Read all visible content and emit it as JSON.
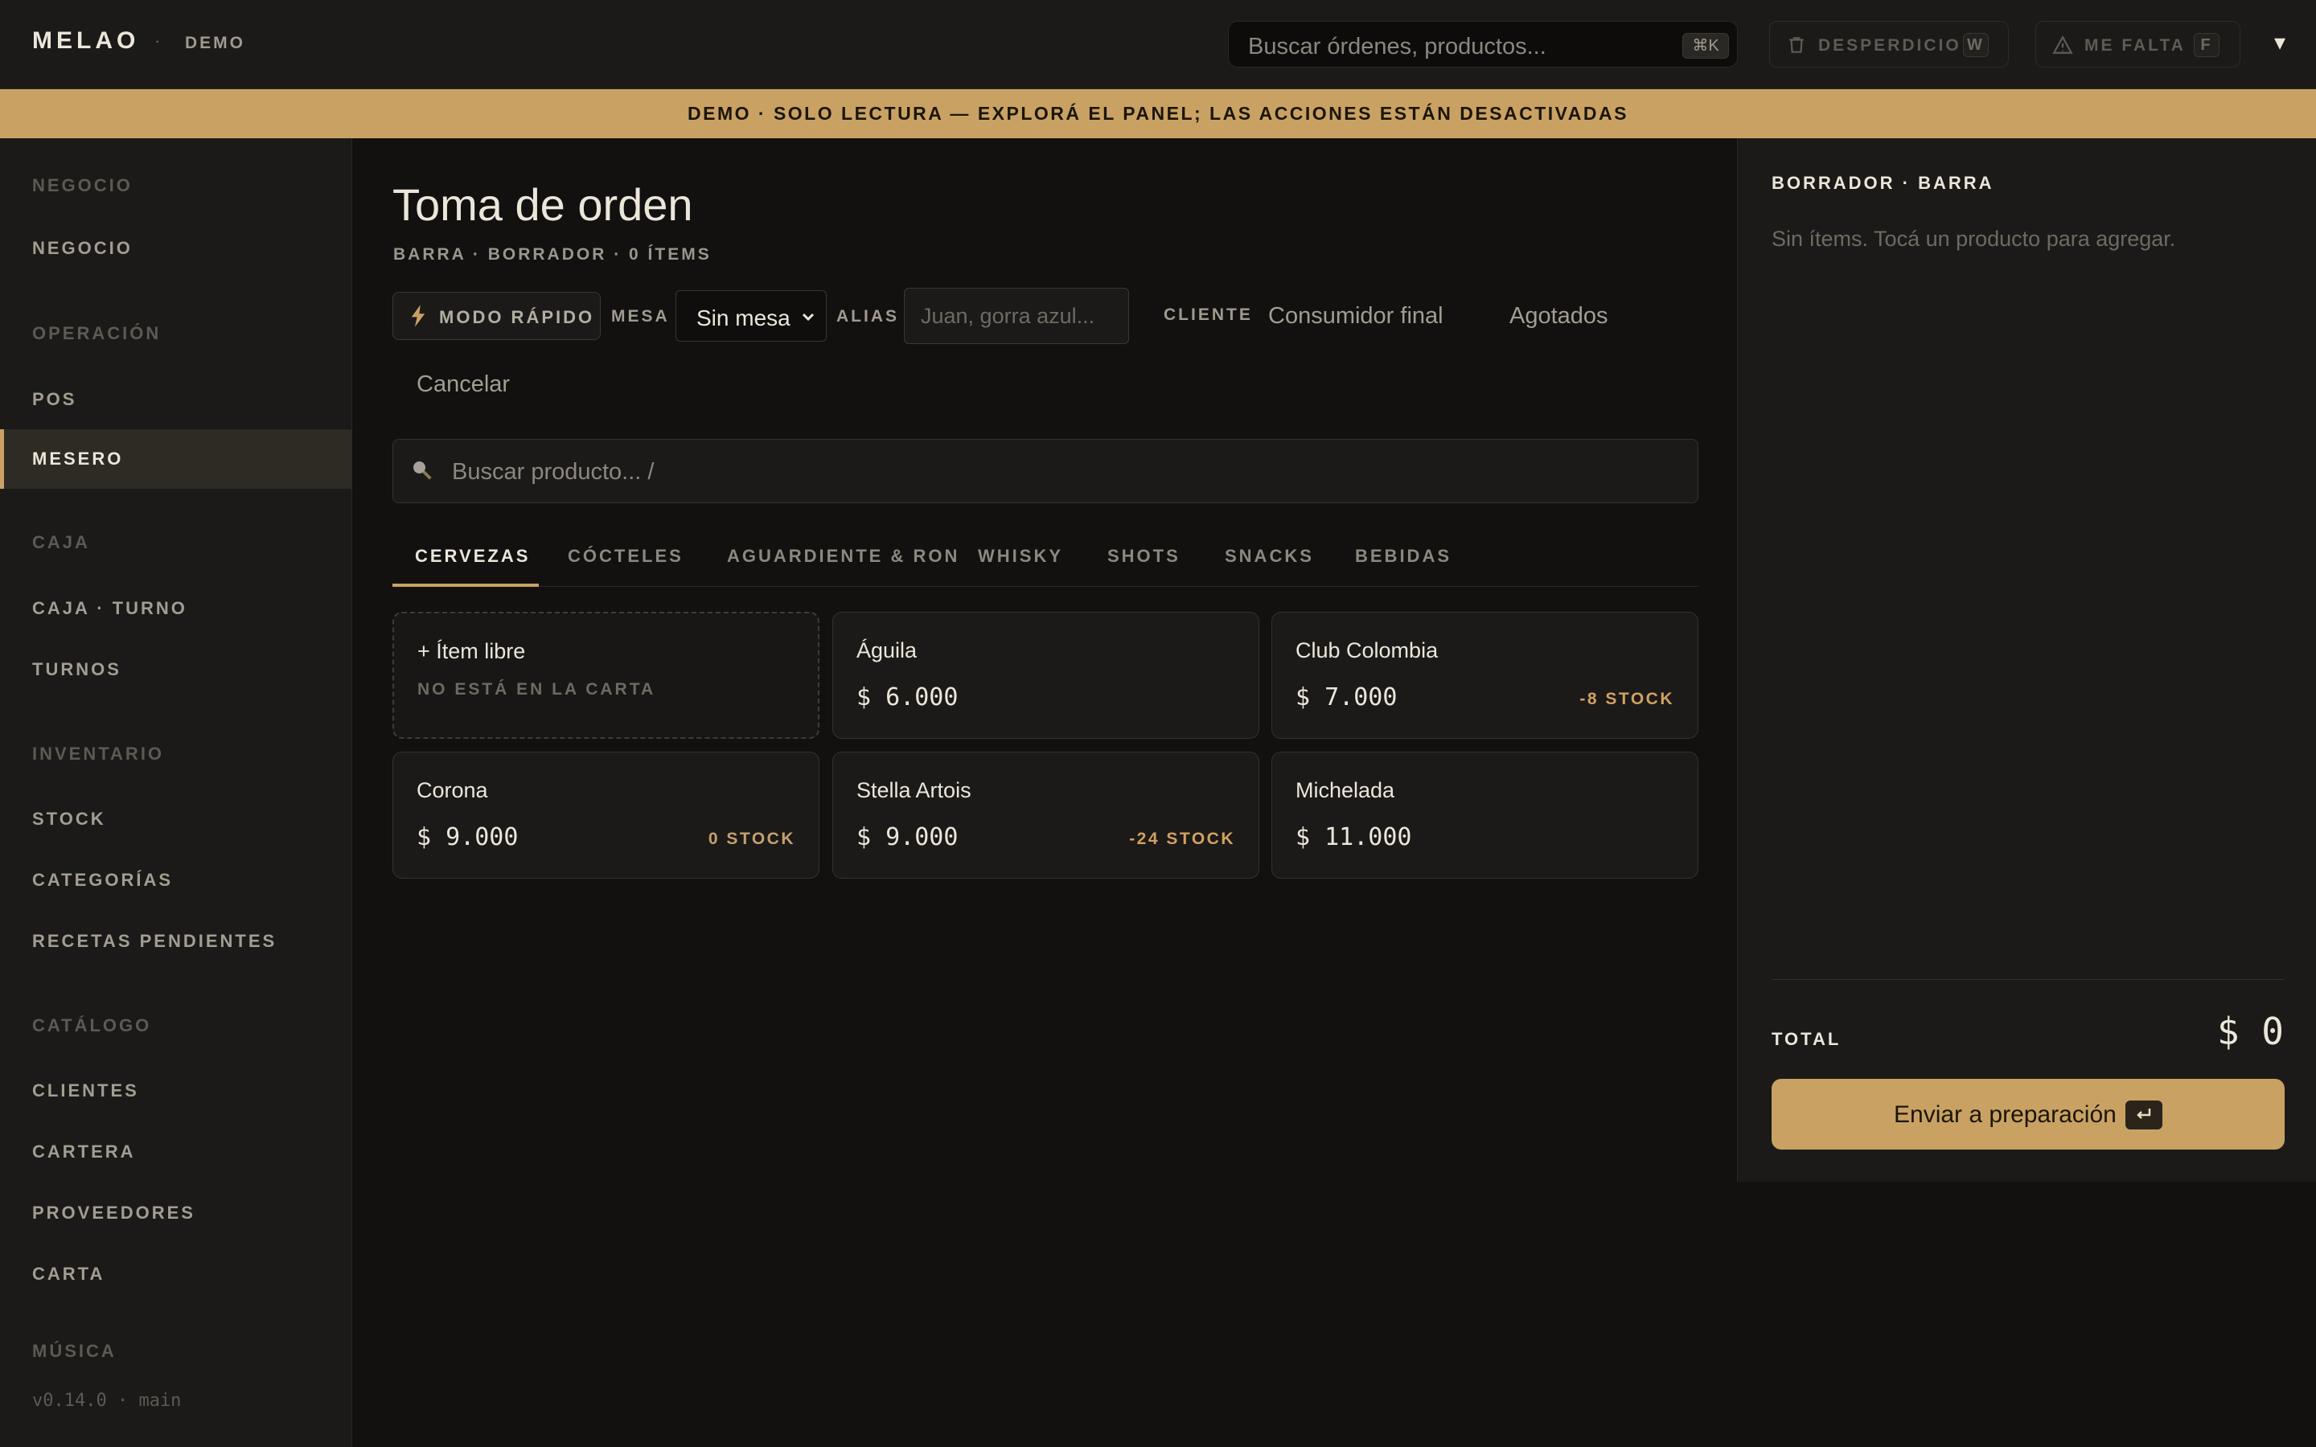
{
  "topbar": {
    "brand": "MELAO",
    "separator": "·",
    "badge": "DEMO",
    "search_placeholder": "Buscar órdenes, productos...",
    "search_shortcut": "⌘K",
    "waste_label": "DESPERDICIO",
    "waste_shortcut": "W",
    "missing_label": "ME FALTA",
    "missing_shortcut": "F",
    "more": "▾"
  },
  "banner": "DEMO · SOLO LECTURA — EXPLORÁ EL PANEL; LAS ACCIONES ESTÁN DESACTIVADAS",
  "sidebar": {
    "sections": [
      {
        "title": "NEGOCIO",
        "items": [
          "NEGOCIO"
        ]
      },
      {
        "title": "OPERACIÓN",
        "items": [
          "POS",
          "MESERO"
        ]
      },
      {
        "title": "CAJA",
        "items": [
          "CAJA · TURNO",
          "TURNOS"
        ]
      },
      {
        "title": "INVENTARIO",
        "items": [
          "STOCK",
          "CATEGORÍAS",
          "RECETAS PENDIENTES"
        ]
      },
      {
        "title": "CATÁLOGO",
        "items": [
          "CLIENTES",
          "CARTERA",
          "PROVEEDORES",
          "CARTA"
        ]
      },
      {
        "title": "MÚSICA",
        "items": []
      }
    ],
    "active": "MESERO",
    "version": "v0.14.0 · main"
  },
  "main": {
    "title": "Toma de orden",
    "subtitle": "BARRA · BORRADOR · 0 ÍTEMS",
    "quick_mode": "MODO RÁPIDO",
    "mesa_label": "MESA",
    "mesa_value": "Sin mesa",
    "alias_label": "ALIAS",
    "alias_placeholder": "Juan, gorra azul...",
    "cliente_label": "CLIENTE",
    "cliente_value": "Consumidor final",
    "agotados": "Agotados",
    "cancel": "Cancelar",
    "product_search_placeholder": "Buscar producto...  /",
    "tabs": [
      "CERVEZAS",
      "CÓCTELES",
      "AGUARDIENTE & RON",
      "WHISKY",
      "SHOTS",
      "SNACKS",
      "BEBIDAS"
    ],
    "active_tab": "CERVEZAS",
    "free_item": {
      "label": "+ Ítem libre",
      "note": "NO ESTÁ EN LA CARTA"
    },
    "products": [
      {
        "name": "Águila",
        "price": "$ 6.000",
        "stock": ""
      },
      {
        "name": "Club Colombia",
        "price": "$ 7.000",
        "stock": "-8 STOCK"
      },
      {
        "name": "Corona",
        "price": "$ 9.000",
        "stock": "0 STOCK"
      },
      {
        "name": "Stella Artois",
        "price": "$ 9.000",
        "stock": "-24 STOCK"
      },
      {
        "name": "Michelada",
        "price": "$ 11.000",
        "stock": ""
      }
    ]
  },
  "order": {
    "title": "BORRADOR · BARRA",
    "empty": "Sin ítems. Tocá un producto para agregar.",
    "total_label": "TOTAL",
    "total_value": "$ 0",
    "send_label": "Enviar a preparación"
  },
  "colors": {
    "accent": "#c9a263",
    "stock_warning": "#d1a163",
    "background": "#121110",
    "panel": "#1b1a18"
  }
}
